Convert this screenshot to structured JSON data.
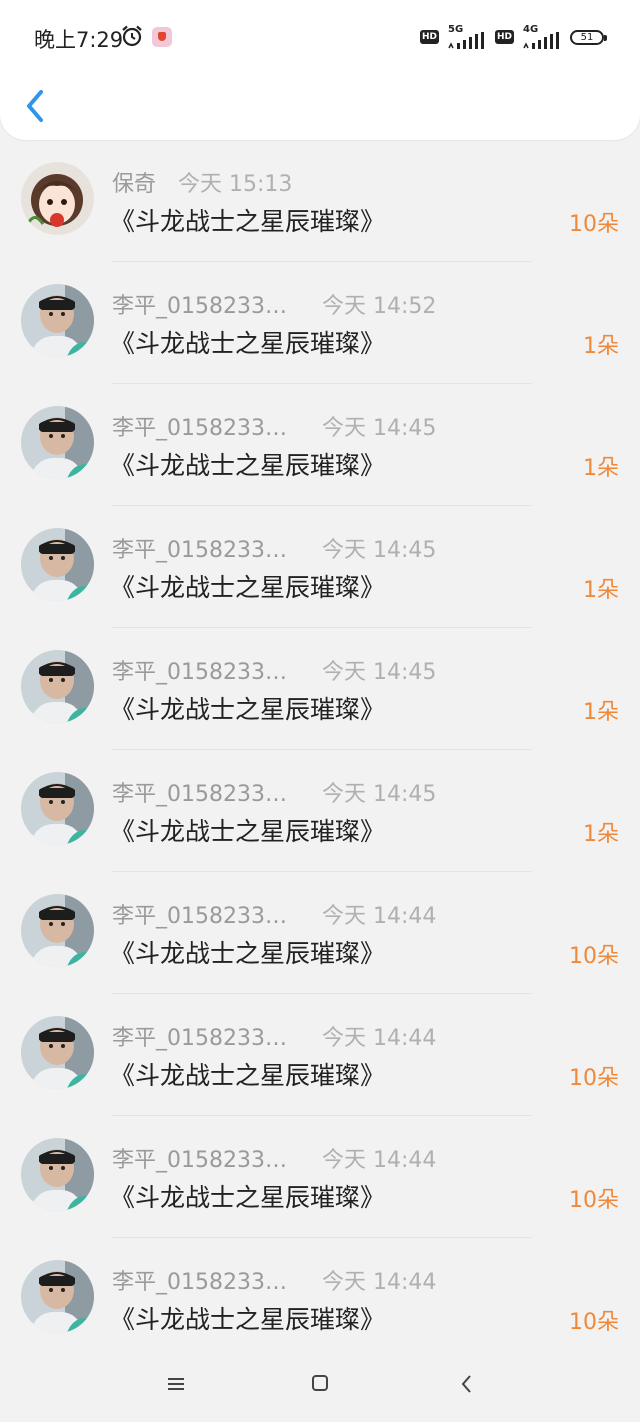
{
  "status_bar": {
    "time": "晚上7:29",
    "hd1": "HD",
    "net1": "5G",
    "hd2": "HD",
    "net2": "4G",
    "battery": "51"
  },
  "colors": {
    "accent": "#2f95e8",
    "count": "#f0883a"
  },
  "rows": [
    {
      "name": "保奇",
      "time": "今天 15:13",
      "book": "《斗龙战士之星辰璀璨》",
      "count": "10朵"
    },
    {
      "name": "李平_0158233…",
      "time": "今天 14:52",
      "book": "《斗龙战士之星辰璀璨》",
      "count": "1朵"
    },
    {
      "name": "李平_0158233…",
      "time": "今天 14:45",
      "book": "《斗龙战士之星辰璀璨》",
      "count": "1朵"
    },
    {
      "name": "李平_0158233…",
      "time": "今天 14:45",
      "book": "《斗龙战士之星辰璀璨》",
      "count": "1朵"
    },
    {
      "name": "李平_0158233…",
      "time": "今天 14:45",
      "book": "《斗龙战士之星辰璀璨》",
      "count": "1朵"
    },
    {
      "name": "李平_0158233…",
      "time": "今天 14:45",
      "book": "《斗龙战士之星辰璀璨》",
      "count": "1朵"
    },
    {
      "name": "李平_0158233…",
      "time": "今天 14:44",
      "book": "《斗龙战士之星辰璀璨》",
      "count": "10朵"
    },
    {
      "name": "李平_0158233…",
      "time": "今天 14:44",
      "book": "《斗龙战士之星辰璀璨》",
      "count": "10朵"
    },
    {
      "name": "李平_0158233…",
      "time": "今天 14:44",
      "book": "《斗龙战士之星辰璀璨》",
      "count": "10朵"
    },
    {
      "name": "李平_0158233…",
      "time": "今天 14:44",
      "book": "《斗龙战士之星辰璀璨》",
      "count": "10朵"
    }
  ],
  "icons": {
    "back": "back-chevron-icon",
    "alarm": "alarm-clock-icon",
    "nav_menu": "menu-icon",
    "nav_home": "home-square-icon",
    "nav_back": "back-icon"
  }
}
